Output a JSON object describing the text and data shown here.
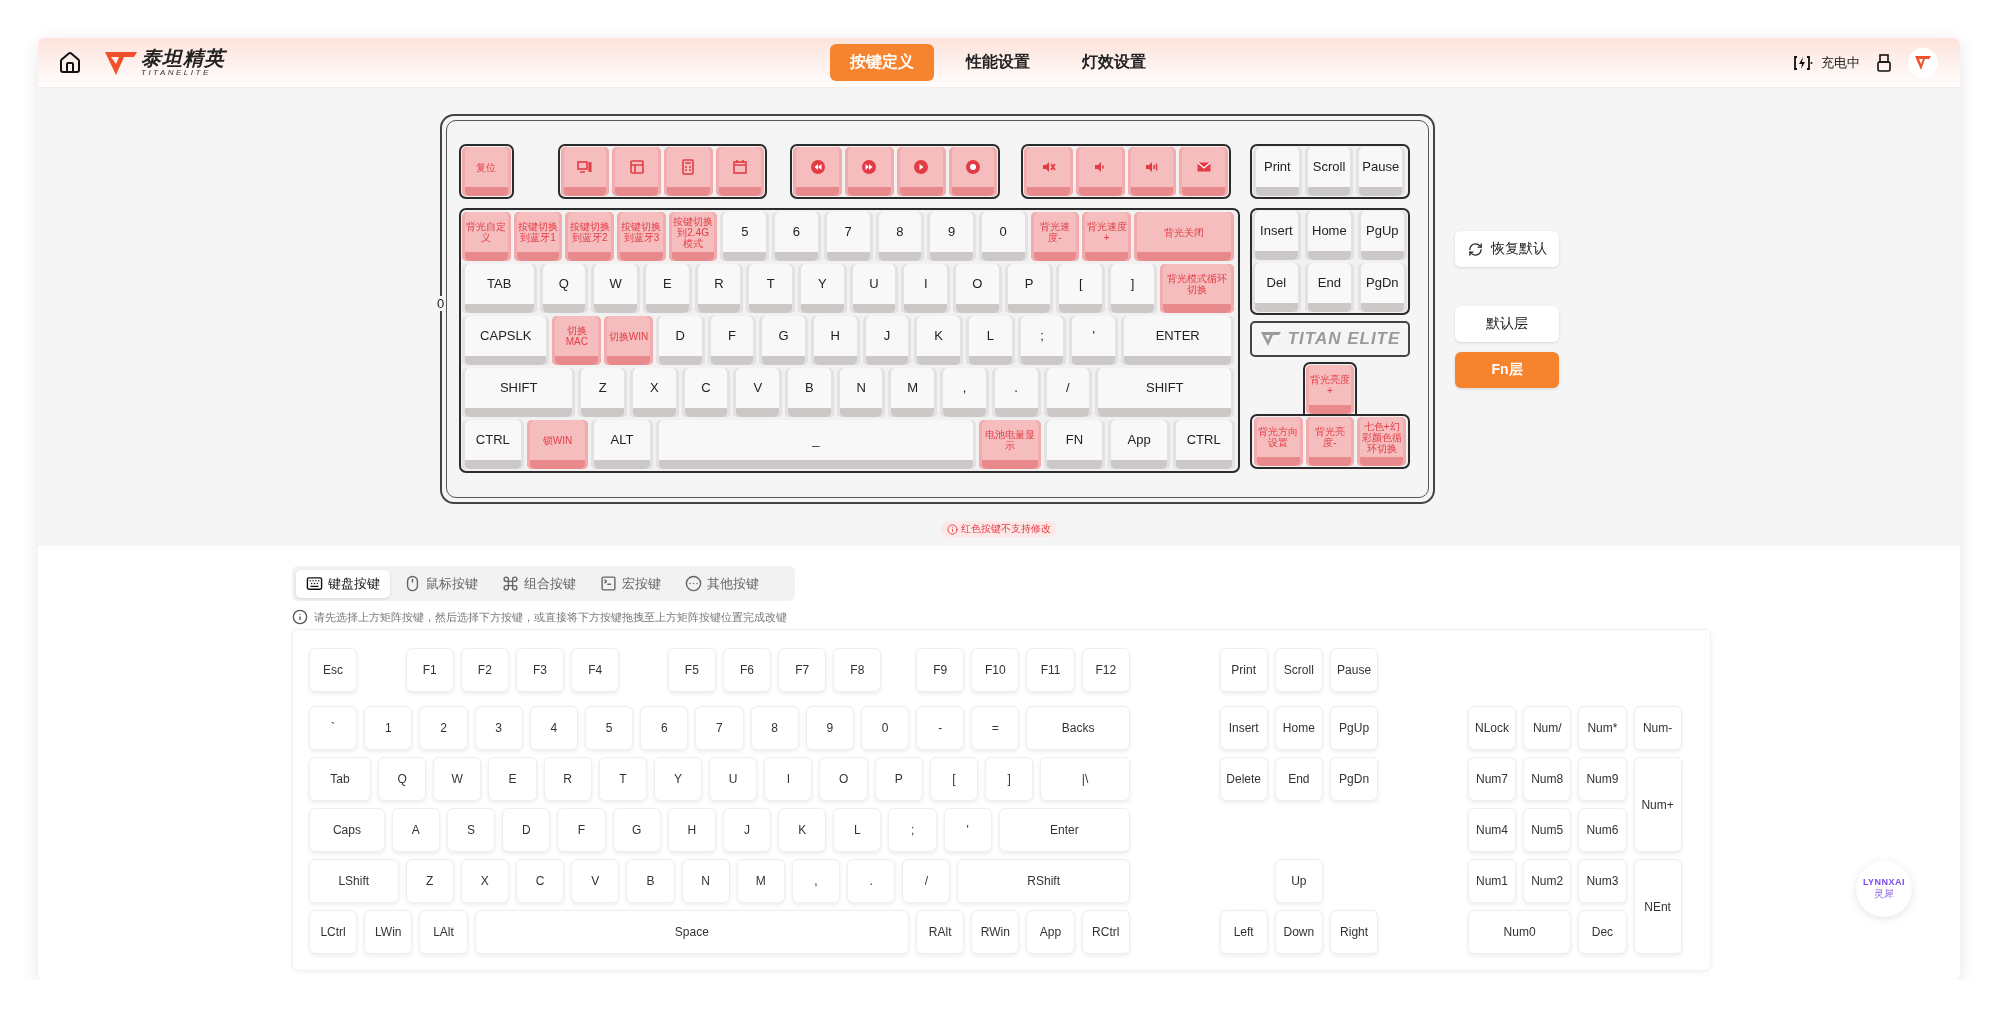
{
  "header": {
    "logo_name": "泰坦精英",
    "logo_subtitle": "TITANELITE",
    "status": "充电中",
    "tabs": [
      {
        "label": "按键定义",
        "selected": true
      },
      {
        "label": "性能设置",
        "selected": false
      },
      {
        "label": "灯效设置",
        "selected": false
      }
    ]
  },
  "keyboard": {
    "side_mark": "0",
    "fn_groups": [
      [
        {
          "kind": "text",
          "label": "复位",
          "locked": true
        }
      ],
      [
        {
          "kind": "icon",
          "locked": true
        },
        {
          "kind": "icon",
          "locked": true
        },
        {
          "kind": "icon",
          "locked": true
        },
        {
          "kind": "icon",
          "locked": true
        }
      ],
      [
        {
          "kind": "icon",
          "locked": true
        },
        {
          "kind": "icon",
          "locked": true
        },
        {
          "kind": "icon",
          "locked": true
        },
        {
          "kind": "icon",
          "locked": true
        }
      ],
      [
        {
          "kind": "icon",
          "locked": true
        },
        {
          "kind": "icon",
          "locked": true
        },
        {
          "kind": "icon",
          "locked": true
        },
        {
          "kind": "icon",
          "locked": true
        }
      ]
    ],
    "print_group": [
      {
        "label": "Print",
        "locked": false
      },
      {
        "label": "Scroll",
        "locked": false
      },
      {
        "label": "Pause",
        "locked": false
      }
    ],
    "main_rows": [
      [
        {
          "label": "背光自定义",
          "locked": true
        },
        {
          "label": "按键切换到蓝牙1",
          "locked": true
        },
        {
          "label": "按键切换到蓝牙2",
          "locked": true
        },
        {
          "label": "按键切换到蓝牙3",
          "locked": true
        },
        {
          "label": "按键切换到2.4G模式",
          "locked": true
        },
        {
          "label": "5",
          "locked": false
        },
        {
          "label": "6",
          "locked": false
        },
        {
          "label": "7",
          "locked": false
        },
        {
          "label": "8",
          "locked": false
        },
        {
          "label": "9",
          "locked": false
        },
        {
          "label": "0",
          "locked": false
        },
        {
          "label": "背光速度-",
          "locked": true
        },
        {
          "label": "背光速度+",
          "locked": true
        },
        {
          "label": "背光关闭",
          "locked": true
        }
      ],
      [
        {
          "label": "TAB",
          "locked": false
        },
        {
          "label": "Q",
          "locked": false
        },
        {
          "label": "W",
          "locked": false
        },
        {
          "label": "E",
          "locked": false
        },
        {
          "label": "R",
          "locked": false
        },
        {
          "label": "T",
          "locked": false
        },
        {
          "label": "Y",
          "locked": false
        },
        {
          "label": "U",
          "locked": false
        },
        {
          "label": "I",
          "locked": false
        },
        {
          "label": "O",
          "locked": false
        },
        {
          "label": "P",
          "locked": false
        },
        {
          "label": "[",
          "locked": false
        },
        {
          "label": "]",
          "locked": false
        },
        {
          "label": "背光模式循环切换",
          "locked": true
        }
      ],
      [
        {
          "label": "CAPSLK",
          "locked": false
        },
        {
          "label": "切换MAC",
          "locked": true
        },
        {
          "label": "切换WIN",
          "locked": true
        },
        {
          "label": "D",
          "locked": false
        },
        {
          "label": "F",
          "locked": false
        },
        {
          "label": "G",
          "locked": false
        },
        {
          "label": "H",
          "locked": false
        },
        {
          "label": "J",
          "locked": false
        },
        {
          "label": "K",
          "locked": false
        },
        {
          "label": "L",
          "locked": false
        },
        {
          "label": ";",
          "locked": false
        },
        {
          "label": "'",
          "locked": false
        },
        {
          "label": "ENTER",
          "locked": false
        }
      ],
      [
        {
          "label": "SHIFT",
          "locked": false
        },
        {
          "label": "Z",
          "locked": false
        },
        {
          "label": "X",
          "locked": false
        },
        {
          "label": "C",
          "locked": false
        },
        {
          "label": "V",
          "locked": false
        },
        {
          "label": "B",
          "locked": false
        },
        {
          "label": "N",
          "locked": false
        },
        {
          "label": "M",
          "locked": false
        },
        {
          "label": ",",
          "locked": false
        },
        {
          "label": ".",
          "locked": false
        },
        {
          "label": "/",
          "locked": false
        },
        {
          "label": "SHIFT",
          "locked": false
        }
      ],
      [
        {
          "label": "CTRL",
          "locked": false
        },
        {
          "label": "锁WIN",
          "locked": true
        },
        {
          "label": "ALT",
          "locked": false
        },
        {
          "label": "_",
          "locked": false
        },
        {
          "label": "电池电量显示",
          "locked": true
        },
        {
          "label": "FN",
          "locked": false
        },
        {
          "label": "App",
          "locked": false
        },
        {
          "label": "CTRL",
          "locked": false
        }
      ]
    ],
    "nav_keys": [
      {
        "label": "Insert",
        "locked": false
      },
      {
        "label": "Home",
        "locked": false
      },
      {
        "label": "PgUp",
        "locked": false
      },
      {
        "label": "Del",
        "locked": false
      },
      {
        "label": "End",
        "locked": false
      },
      {
        "label": "PgDn",
        "locked": false
      }
    ],
    "brand": "TITAN ELITE",
    "arrow_up": {
      "label": "背光亮度+",
      "locked": true
    },
    "arrow_row": [
      {
        "label": "背光方向设置",
        "locked": true
      },
      {
        "label": "背光亮度-",
        "locked": true
      },
      {
        "label": "七色+幻彩颜色循环切换",
        "locked": true
      }
    ]
  },
  "restore_button": "恢复默认",
  "layers": [
    {
      "label": "默认层",
      "selected": false
    },
    {
      "label": "Fn层",
      "selected": true
    }
  ],
  "warning": "红色按键不支持修改",
  "key_tabs": [
    {
      "label": "键盘按键",
      "selected": true
    },
    {
      "label": "鼠标按键",
      "selected": false
    },
    {
      "label": "组合按键",
      "selected": false
    },
    {
      "label": "宏按键",
      "selected": false
    },
    {
      "label": "其他按键",
      "selected": false
    }
  ],
  "hint": "请先选择上方矩阵按键，然后选择下方按键，或直接将下方按键拖拽至上方矩阵按键位置完成改键",
  "key_panel": {
    "main_rows": [
      [
        "Esc",
        "F1",
        "F2",
        "F3",
        "F4",
        "F5",
        "F6",
        "F7",
        "F8",
        "F9",
        "F10",
        "F11",
        "F12"
      ],
      [
        "`",
        "1",
        "2",
        "3",
        "4",
        "5",
        "6",
        "7",
        "8",
        "9",
        "0",
        "-",
        "=",
        "Backs"
      ],
      [
        "Tab",
        "Q",
        "W",
        "E",
        "R",
        "T",
        "Y",
        "U",
        "I",
        "O",
        "P",
        "[",
        "]",
        "|\\"
      ],
      [
        "Caps",
        "A",
        "S",
        "D",
        "F",
        "G",
        "H",
        "J",
        "K",
        "L",
        ";",
        "'",
        "Enter"
      ],
      [
        "LShift",
        "Z",
        "X",
        "C",
        "V",
        "B",
        "N",
        "M",
        ",",
        ".",
        "/",
        "RShift"
      ],
      [
        "LCtrl",
        "LWin",
        "LAlt",
        "Space",
        "RAlt",
        "RWin",
        "App",
        "RCtrl"
      ]
    ],
    "nav_keys": [
      "Print",
      "Scroll",
      "Pause",
      "Insert",
      "Home",
      "PgUp",
      "Delete",
      "End",
      "PgDn",
      "Up",
      "Left",
      "Down",
      "Right"
    ],
    "numpad_keys": [
      "NLock",
      "Num/",
      "Num*",
      "Num-",
      "Num7",
      "Num8",
      "Num9",
      "Num+",
      "Num4",
      "Num5",
      "Num6",
      "Num1",
      "Num2",
      "Num3",
      "NEnt",
      "Num0",
      "Dec"
    ]
  },
  "assistant": {
    "name": "LYNNXAI",
    "subtitle": "灵犀"
  }
}
